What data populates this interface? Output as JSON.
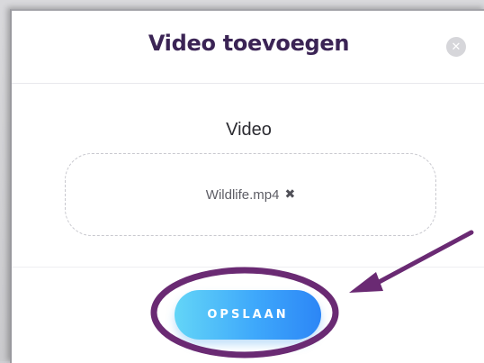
{
  "modal": {
    "title": "Video toevoegen",
    "close_icon": "close-icon"
  },
  "form": {
    "label": "Video",
    "file_name": "Wildlife.mp4",
    "remove_icon": "x-icon"
  },
  "actions": {
    "save_label": "OPSLAAN"
  },
  "annotation": {
    "arrow_icon": "arrow-icon",
    "color": "#6a2a73"
  },
  "colors": {
    "title": "#3b2455",
    "button_gradient_start": "#63d5f7",
    "button_gradient_end": "#2c86f6",
    "annotation": "#6a2a73"
  }
}
